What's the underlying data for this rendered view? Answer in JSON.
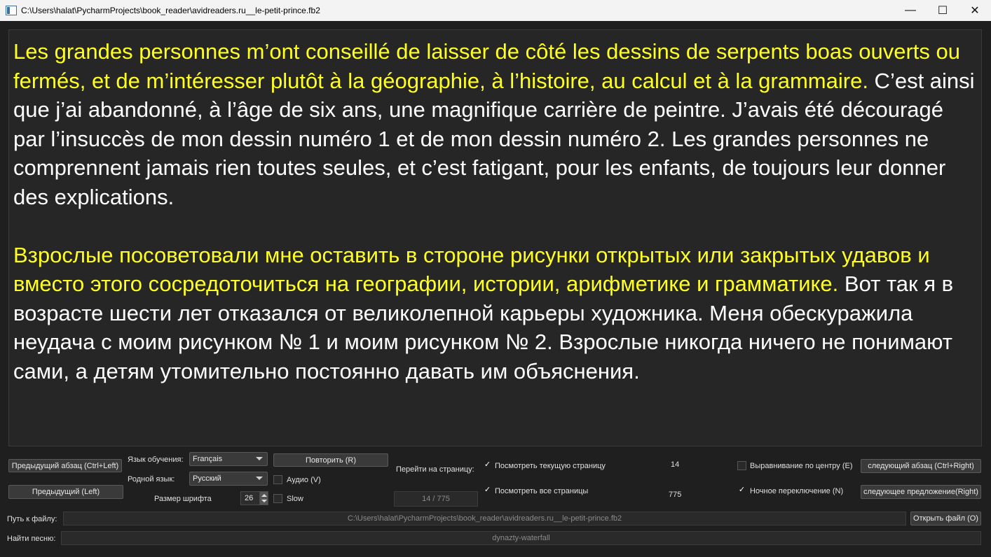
{
  "window": {
    "title": "C:\\Users\\halat\\PycharmProjects\\book_reader\\avidreaders.ru__le-petit-prince.fb2",
    "minimize_glyph": "—",
    "maximize_glyph": "☐",
    "close_glyph": "✕"
  },
  "reader": {
    "p1_highlight": "Les grandes personnes m’ont conseillé de laisser de côté les dessins de serpents boas ouverts ou fermés, et de m’intéresser plutôt à la géographie, à l’histoire, au calcul et à la grammaire.",
    "p1_rest": " C’est ainsi que j’ai abandonné, à l’âge de six ans, une magnifique carrière de peintre. J’avais été découragé par l’insuccès de mon dessin numéro 1 et de mon dessin numéro 2. Les grandes personnes ne comprennent jamais rien toutes seules, et c’est fatigant, pour les enfants, de toujours leur donner des explications.",
    "p2_highlight": "Взрослые посоветовали мне оставить в стороне рисунки открытых или закрытых удавов и вместо этого сосредоточиться на географии, истории, арифметике и грамматике.",
    "p2_rest": " Вот так я в возрасте шести лет отказался от великолепной карьеры художника. Меня обескуражила неудача с моим рисунком № 1 и моим рисунком № 2. Взрослые никогда ничего не понимают сами, а детям утомительно постоянно давать им объяснения."
  },
  "controls": {
    "prev_paragraph": "Предыдущий абзац (Ctrl+Left)",
    "prev": "Предыдущий (Left)",
    "learn_lang_label": "Язык обучения:",
    "learn_lang_value": "Français",
    "native_lang_label": "Родной язык:",
    "native_lang_value": "Русский",
    "font_size_label": "Размер шрифта",
    "font_size_value": "26",
    "repeat": "Повторить (R)",
    "audio": "Аудио (V)",
    "slow": "Slow",
    "goto_page_label": "Перейти на страницу:",
    "page_display": "14 / 775",
    "view_current_page": "Посмотреть текущую страницу",
    "current_page": "14",
    "view_all_pages": "Посмотреть все страницы",
    "total_pages": "775",
    "center_align": "Выравнивание по центру (E)",
    "night_toggle": "Ночное переключение (N)",
    "next_paragraph": "следующий абзац (Ctrl+Right)",
    "next_sentence": "следующее предложение(Right)",
    "file_path_label": "Путь к файлу:",
    "file_path_value": "C:\\Users\\halat\\PycharmProjects\\book_reader\\avidreaders.ru__le-petit-prince.fb2",
    "open_file": "Открыть файл (O)",
    "find_song_label": "Найти песню:",
    "find_song_value": "dynazty-waterfall"
  },
  "colors": {
    "highlight": "#ffff22",
    "text": "#ffffff",
    "background": "#262626"
  }
}
